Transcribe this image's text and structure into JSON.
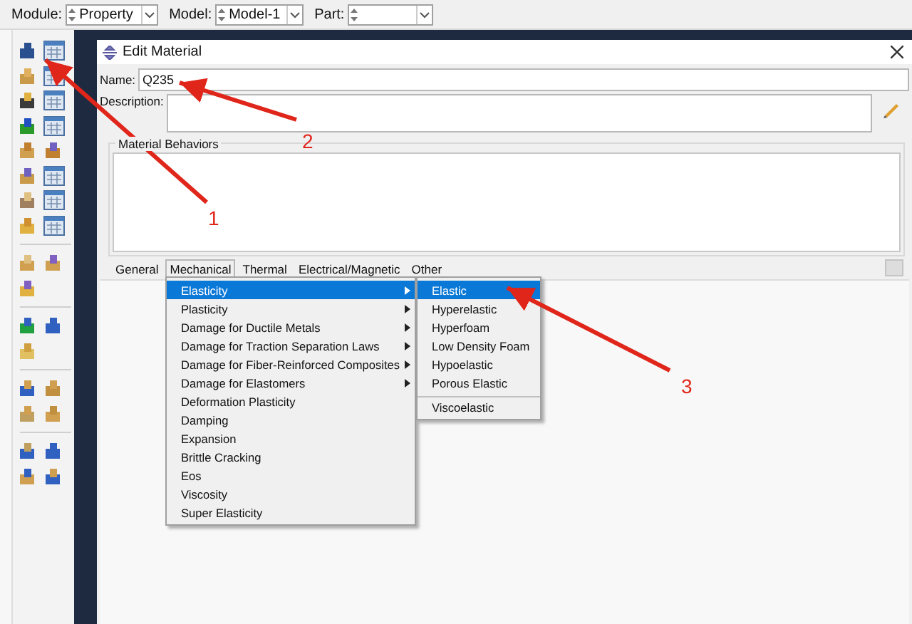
{
  "toolbar": {
    "fields": [
      {
        "label": "Module:",
        "value": "Property"
      },
      {
        "label": "Model:",
        "value": "Model-1"
      },
      {
        "label": "Part:"
      }
    ]
  },
  "dialog": {
    "title": "Edit Material",
    "name_label": "Name:",
    "name_value": "Q235",
    "description_label": "Description:",
    "behaviors_label": "Material Behaviors",
    "tabs": [
      {
        "label": "General",
        "open": false
      },
      {
        "label": "Mechanical",
        "open": true
      },
      {
        "label": "Thermal",
        "open": false
      },
      {
        "label": "Electrical/Magnetic",
        "open": false
      },
      {
        "label": "Other",
        "open": false
      }
    ]
  },
  "menu": [
    {
      "label": "Elasticity",
      "submenu": true,
      "selected": true
    },
    {
      "label": "Plasticity",
      "submenu": true,
      "selected": false
    },
    {
      "label": "Damage for Ductile Metals",
      "submenu": true,
      "selected": false
    },
    {
      "label": "Damage for Traction Separation Laws",
      "submenu": true,
      "selected": false
    },
    {
      "label": "Damage for Fiber-Reinforced Composites",
      "submenu": true,
      "selected": false
    },
    {
      "label": "Damage for Elastomers",
      "submenu": true,
      "selected": false
    },
    {
      "label": "Deformation Plasticity",
      "submenu": false,
      "selected": false
    },
    {
      "label": "Damping",
      "submenu": false,
      "selected": false
    },
    {
      "label": "Expansion",
      "submenu": false,
      "selected": false
    },
    {
      "label": "Brittle Cracking",
      "submenu": false,
      "selected": false
    },
    {
      "label": "Eos",
      "submenu": false,
      "selected": false
    },
    {
      "label": "Viscosity",
      "submenu": false,
      "selected": false
    },
    {
      "label": "Super Elasticity",
      "submenu": false,
      "selected": false
    }
  ],
  "submenu": [
    {
      "label": "Elastic",
      "selected": true,
      "separator_before": false
    },
    {
      "label": "Hyperelastic",
      "selected": false,
      "separator_before": false
    },
    {
      "label": "Hyperfoam",
      "selected": false,
      "separator_before": false
    },
    {
      "label": "Low Density Foam",
      "selected": false,
      "separator_before": false
    },
    {
      "label": "Hypoelastic",
      "selected": false,
      "separator_before": false
    },
    {
      "label": "Porous Elastic",
      "selected": false,
      "separator_before": false
    },
    {
      "label": "Viscoelastic",
      "selected": false,
      "separator_before": true
    }
  ],
  "annotations": [
    {
      "label": "1"
    },
    {
      "label": "2"
    },
    {
      "label": "3"
    }
  ]
}
